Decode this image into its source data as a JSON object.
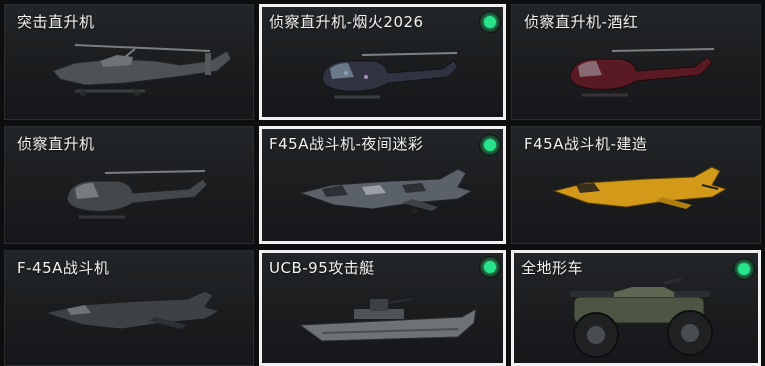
{
  "vehicles": [
    {
      "name": "突击直升机",
      "owned": false,
      "selected": false,
      "icon": "attack-helicopter-icon"
    },
    {
      "name": "侦察直升机-烟火2026",
      "owned": true,
      "selected": true,
      "icon": "scout-helicopter-fireworks-icon"
    },
    {
      "name": "侦察直升机-酒红",
      "owned": false,
      "selected": false,
      "icon": "scout-helicopter-burgundy-icon"
    },
    {
      "name": "侦察直升机",
      "owned": false,
      "selected": false,
      "icon": "scout-helicopter-icon"
    },
    {
      "name": "F45A战斗机-夜间迷彩",
      "owned": true,
      "selected": true,
      "icon": "fighter-jet-night-camo-icon"
    },
    {
      "name": "F45A战斗机-建造",
      "owned": false,
      "selected": false,
      "icon": "fighter-jet-construction-icon"
    },
    {
      "name": "F-45A战斗机",
      "owned": false,
      "selected": false,
      "icon": "fighter-jet-icon"
    },
    {
      "name": "UCB-95攻击艇",
      "owned": true,
      "selected": true,
      "icon": "attack-boat-icon"
    },
    {
      "name": "全地形车",
      "owned": true,
      "selected": true,
      "icon": "atv-icon"
    }
  ],
  "colors": {
    "owned_badge": "#27e38a",
    "selected_border": "#f1f1f1",
    "card_bg": "#1a1c1e",
    "page_bg": "#0c0e0f"
  }
}
